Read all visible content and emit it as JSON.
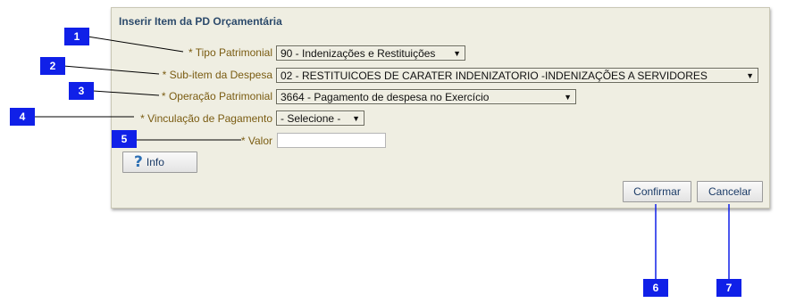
{
  "dialog": {
    "title": "Inserir Item da PD Orçamentária"
  },
  "fields": {
    "tipo_patrimonial": {
      "required_mark": "*",
      "label": "Tipo Patrimonial",
      "value": "90 - Indenizações e Restituições"
    },
    "sub_item": {
      "required_mark": "*",
      "label": "Sub-item da Despesa",
      "value": "02 - RESTITUICOES DE CARATER INDENIZATORIO -INDENIZAÇÕES A SERVIDORES"
    },
    "operacao": {
      "required_mark": "*",
      "label": "Operação Patrimonial",
      "value": "3664 - Pagamento de despesa no Exercício"
    },
    "vinculacao": {
      "required_mark": "*",
      "label": "Vinculação de Pagamento",
      "value": "- Selecione -"
    },
    "valor": {
      "required_mark": "*",
      "label": "Valor",
      "value": ""
    }
  },
  "buttons": {
    "info": "Info",
    "confirmar": "Confirmar",
    "cancelar": "Cancelar"
  },
  "callouts": [
    "1",
    "2",
    "3",
    "4",
    "5",
    "6",
    "7"
  ],
  "colors": {
    "callout": "#1020e8",
    "panel_bg": "#efeee2",
    "label": "#7a5c12",
    "title": "#2c4a6b"
  },
  "icons": {
    "select_arrow": "triangle-down-icon",
    "info": "question-mark-icon"
  }
}
